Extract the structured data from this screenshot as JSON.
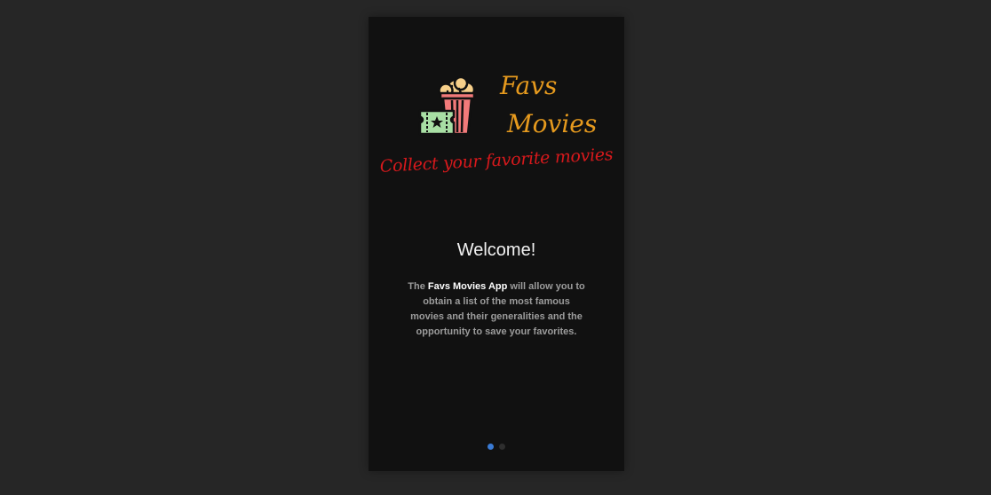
{
  "brand": {
    "line1": "Favs",
    "line2": "Movies",
    "tagline": "Collect your favorite movies",
    "logo_icon": "popcorn-ticket-icon"
  },
  "welcome": {
    "title": "Welcome!",
    "text_before": "The ",
    "app_name": "Favs Movies App",
    "text_after": " will allow you to obtain a list of the most famous movies and their generalities and the opportunity to save your favorites."
  },
  "pagination": {
    "total": 2,
    "active_index": 0
  },
  "colors": {
    "background": "#262626",
    "screen": "#111111",
    "brand": "#e69a1e",
    "tagline": "#d8191c",
    "active_dot": "#3a7bd5",
    "inactive_dot": "#2e2e2e"
  }
}
